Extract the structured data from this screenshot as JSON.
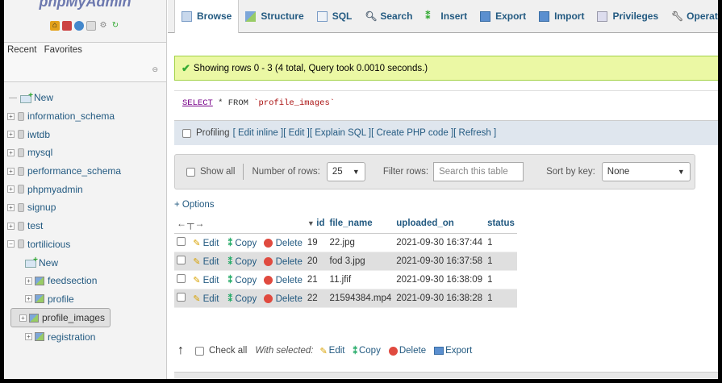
{
  "app": {
    "logo_text": "phpMyAdmin"
  },
  "sidebar": {
    "tab_recent": "Recent",
    "tab_favorites": "Favorites",
    "items": [
      {
        "label": "New",
        "type": "new",
        "level": 0
      },
      {
        "label": "information_schema",
        "type": "db",
        "level": 0
      },
      {
        "label": "iwtdb",
        "type": "db",
        "level": 0
      },
      {
        "label": "mysql",
        "type": "db",
        "level": 0
      },
      {
        "label": "performance_schema",
        "type": "db",
        "level": 0
      },
      {
        "label": "phpmyadmin",
        "type": "db",
        "level": 0
      },
      {
        "label": "signup",
        "type": "db",
        "level": 0
      },
      {
        "label": "test",
        "type": "db",
        "level": 0
      },
      {
        "label": "tortilicious",
        "type": "db",
        "level": 0
      },
      {
        "label": "New",
        "type": "new",
        "level": 1
      },
      {
        "label": "feedsection",
        "type": "table",
        "level": 1
      },
      {
        "label": "profile",
        "type": "table",
        "level": 1
      },
      {
        "label": "profile_images",
        "type": "table",
        "level": 1
      },
      {
        "label": "registration",
        "type": "table",
        "level": 1
      }
    ]
  },
  "topmenu": {
    "tabs": [
      "Browse",
      "Structure",
      "SQL",
      "Search",
      "Insert",
      "Export",
      "Import",
      "Privileges",
      "Operations"
    ]
  },
  "main": {
    "success_message": "Showing rows 0 - 3 (4 total, Query took 0.0010 seconds.)",
    "sql": {
      "select": "SELECT",
      "rest": " * FROM ",
      "table": "`profile_images`"
    },
    "profiling": {
      "label": "Profiling",
      "links": [
        "[ Edit inline ]",
        "[ Edit ]",
        "[ Explain SQL ]",
        "[ Create PHP code ]",
        "[ Refresh ]"
      ]
    },
    "navbar": {
      "show_all": "Show all",
      "number_of_rows_label": "Number of rows:",
      "number_of_rows_value": "25",
      "filter_rows_label": "Filter rows:",
      "filter_placeholder": "Search this table",
      "sort_by_key_label": "Sort by key:",
      "sort_by_key_value": "None"
    },
    "options_link": "+ Options",
    "table": {
      "headers": [
        "id",
        "file_name",
        "uploaded_on",
        "status"
      ],
      "actions": {
        "edit": "Edit",
        "copy": "Copy",
        "delete": "Delete"
      },
      "rows": [
        [
          "19",
          "22.jpg",
          "2021-09-30 16:37:44",
          "1"
        ],
        [
          "20",
          "fod 3.jpg",
          "2021-09-30 16:37:58",
          "1"
        ],
        [
          "21",
          "11.jfif",
          "2021-09-30 16:38:09",
          "1"
        ],
        [
          "22",
          "21594384.mp4",
          "2021-09-30 16:38:28",
          "1"
        ]
      ]
    },
    "bottom": {
      "check_all": "Check all",
      "with_selected": "With selected:",
      "edit": "Edit",
      "copy": "Copy",
      "delete": "Delete",
      "export": "Export"
    }
  }
}
